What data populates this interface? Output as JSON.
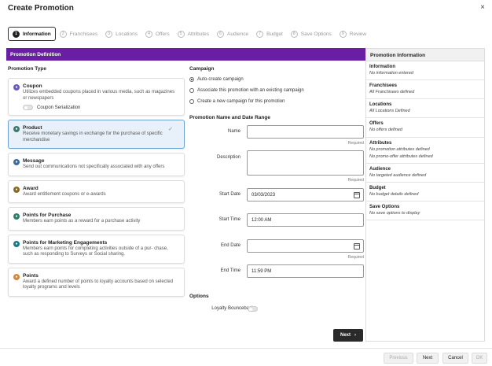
{
  "dialog": {
    "title": "Create Promotion",
    "close": "×"
  },
  "train": [
    {
      "num": "1",
      "label": "Information",
      "active": true
    },
    {
      "num": "2",
      "label": "Franchisees"
    },
    {
      "num": "3",
      "label": "Locations"
    },
    {
      "num": "4",
      "label": "Offers"
    },
    {
      "num": "5",
      "label": "Attributes"
    },
    {
      "num": "6",
      "label": "Audience"
    },
    {
      "num": "7",
      "label": "Budget"
    },
    {
      "num": "8",
      "label": "Save Options"
    },
    {
      "num": "9",
      "label": "Review"
    }
  ],
  "section_title": "Promotion Definition",
  "promotion_type": {
    "title": "Promotion Type",
    "items": [
      {
        "name": "Coupon",
        "desc": "Utilizes embedded coupons placed in various media, such as magazines or newspapers",
        "icon": "coupon-icon",
        "color": "#6a5bc4",
        "toggle_label": "Coupon Serialization"
      },
      {
        "name": "Product",
        "desc": "Receive monetary savings in exchange for the purchase of specific merchandise",
        "icon": "product-icon",
        "color": "#3c7a6e",
        "selected": true
      },
      {
        "name": "Message",
        "desc": "Send out communications not specifically associated with any offers",
        "icon": "message-icon",
        "color": "#3d6d9b"
      },
      {
        "name": "Award",
        "desc": "Award entitlement coupons or e-awards",
        "icon": "award-icon",
        "color": "#8a6a1e"
      },
      {
        "name": "Points for Purchase",
        "desc": "Members earn points as a reward for a purchase activity",
        "icon": "points-purchase-icon",
        "color": "#2d7f6a"
      },
      {
        "name": "Points for Marketing Engagements",
        "desc": "Members earn points for completing activities outside of a pur- chase, such as responding to Surveys or Social sharing.",
        "icon": "points-engagement-icon",
        "color": "#1e7a8a"
      },
      {
        "name": "Points",
        "desc": "Award a defined number of points to loyalty accounts based on selected loyalty programs and levels",
        "icon": "points-icon",
        "color": "#d08a3a"
      }
    ]
  },
  "campaign": {
    "title": "Campaign",
    "options": [
      {
        "label": "Auto-create campaign",
        "checked": true
      },
      {
        "label": "Associate this promotion with an existing campaign"
      },
      {
        "label": "Create a new campaign for this promotion"
      }
    ]
  },
  "name_date": {
    "title": "Promotion Name and Date Range",
    "name_label": "Name",
    "name_value": "",
    "required": "Required",
    "description_label": "Description",
    "description_value": "",
    "start_date_label": "Start Date",
    "start_date_value": "03/03/2023",
    "start_time_label": "Start Time",
    "start_time_value": "12:00 AM",
    "end_date_label": "End Date",
    "end_date_value": "",
    "end_time_label": "End Time",
    "end_time_value": "11:59 PM"
  },
  "options": {
    "title": "Options",
    "loyalty_label": "Loyalty Bounceback"
  },
  "next_button": "Next",
  "info_panel": {
    "title": "Promotion Information",
    "sections": [
      {
        "title": "Information",
        "values": [
          "No information entered"
        ]
      },
      {
        "title": "Franchisees",
        "values": [
          "All Franchisees defined"
        ]
      },
      {
        "title": "Locations",
        "values": [
          "All Locations Defined"
        ]
      },
      {
        "title": "Offers",
        "values": [
          "No offers defined"
        ]
      },
      {
        "title": "Attributes",
        "values": [
          "No promotion attributes defined",
          "No promo-offer attributes defined"
        ]
      },
      {
        "title": "Audience",
        "values": [
          "No targeted audience defined"
        ]
      },
      {
        "title": "Budget",
        "values": [
          "No budget details defined"
        ]
      },
      {
        "title": "Save Options",
        "values": [
          "No save options to display"
        ]
      }
    ]
  },
  "footer": {
    "previous": "Previous",
    "next": "Next",
    "cancel": "Cancel",
    "ok": "OK"
  }
}
